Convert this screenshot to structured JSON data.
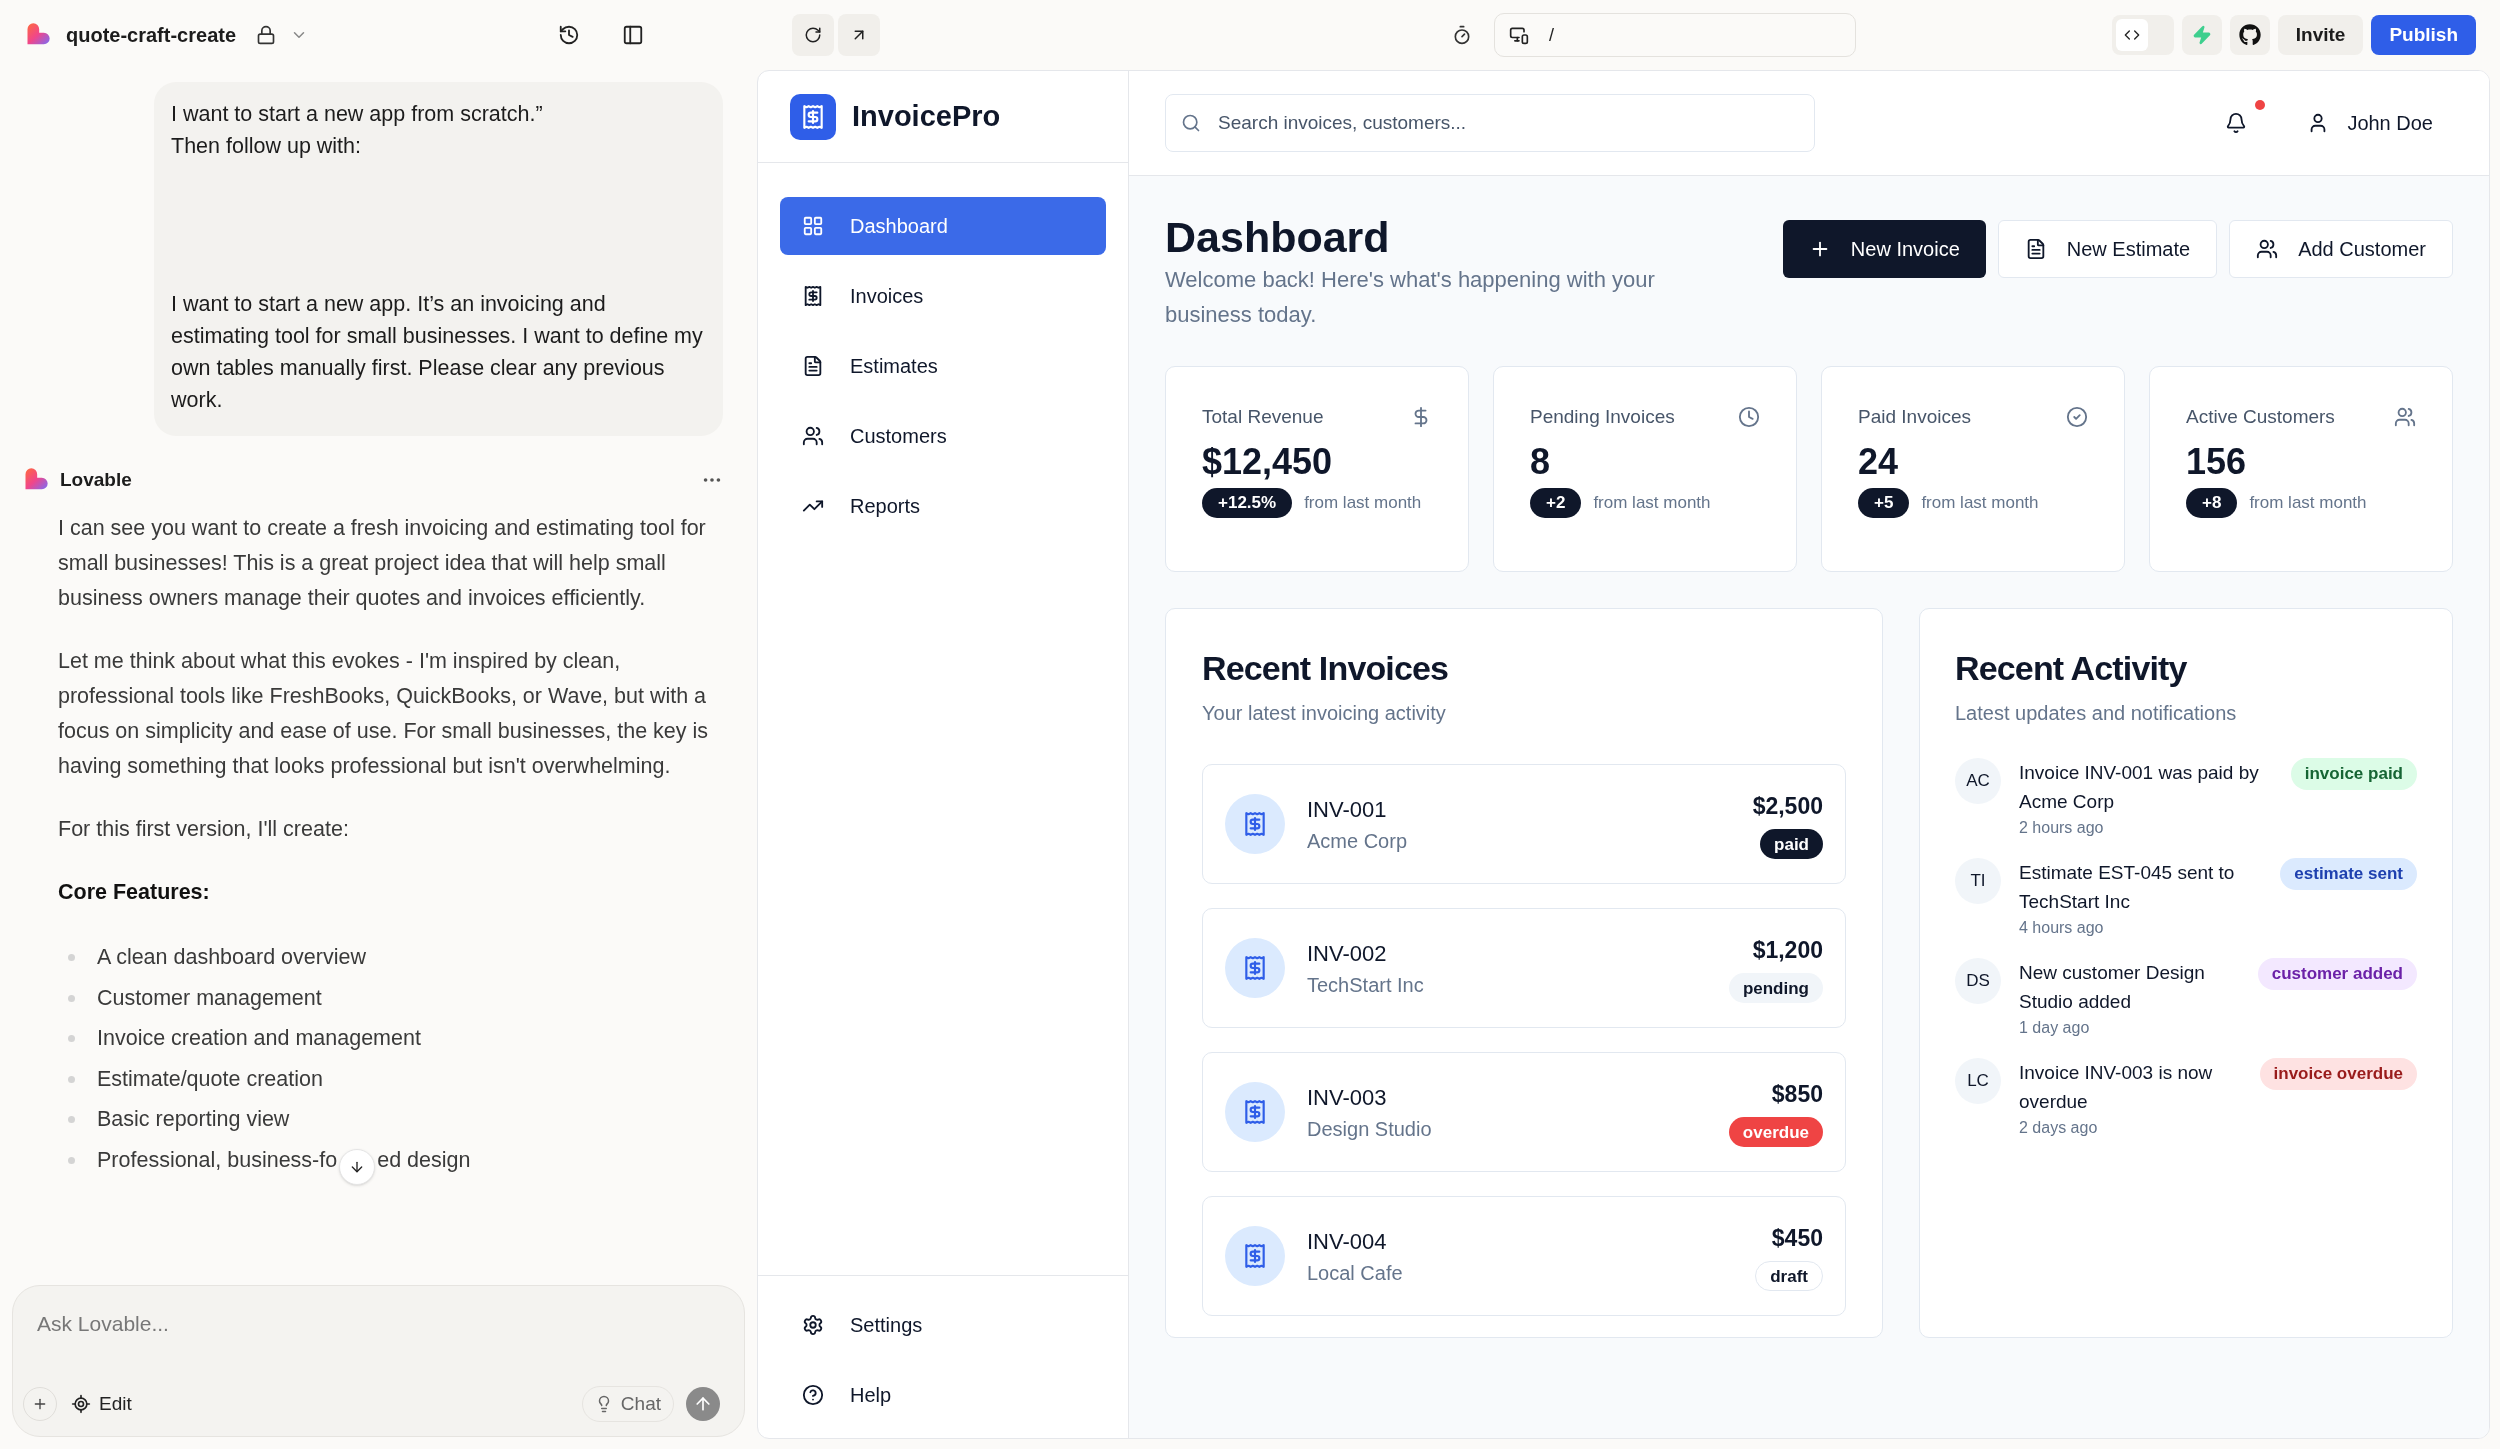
{
  "topbar": {
    "project": "quote-craft-create",
    "route": "/",
    "code_view": false,
    "buttons": [
      "Invite",
      "Publish"
    ]
  },
  "chat": {
    "user_message": [
      "I want to start a new app from scratch.”\nThen follow up with:",
      "I want to start a new app. It’s an invoicing and estimating tool for small businesses. I want to define my own tables manually first. Please clear any previous work."
    ],
    "assistant_name": "Lovable",
    "paragraphs": [
      "I can see you want to create a fresh invoicing and estimating tool for small businesses! This is a great project idea that will help small business owners manage their quotes and invoices efficiently.",
      "Let me think about what this evokes - I'm inspired by clean, professional tools like FreshBooks, QuickBooks, or Wave, but with a focus on simplicity and ease of use. For small businesses, the key is having something that looks professional but isn't overwhelming.",
      "For this first version, I'll create:"
    ],
    "heading": "Core Features:",
    "bullets": [
      [
        "A clean dashboard overview"
      ],
      [
        "Customer management"
      ],
      [
        "Invoice creation and management"
      ],
      [
        "Estimate/quote creation"
      ],
      [
        "Basic reporting view"
      ],
      [
        "Professional, business-fo",
        "ed design"
      ]
    ],
    "composer": {
      "placeholder": "Ask Lovable...",
      "edit": "Edit",
      "chat": "Chat"
    }
  },
  "app": {
    "brand": "InvoicePro",
    "nav": [
      {
        "label": "Dashboard",
        "selected": true
      },
      {
        "label": "Invoices",
        "selected": false
      },
      {
        "label": "Estimates",
        "selected": false
      },
      {
        "label": "Customers",
        "selected": false
      },
      {
        "label": "Reports",
        "selected": false
      }
    ],
    "nav_bottom": [
      "Settings",
      "Help"
    ],
    "search": {
      "placeholder": "Search invoices, customers..."
    },
    "notifications_unread": true,
    "user": "John Doe",
    "title": "Dashboard",
    "subtitle": "Welcome back! Here's what's happening with your business today.",
    "actions": [
      {
        "label": "New Invoice",
        "primary": true
      },
      {
        "label": "New Estimate",
        "primary": false
      },
      {
        "label": "Add Customer",
        "primary": false
      }
    ],
    "stats": [
      {
        "label": "Total Revenue",
        "value": "$12,450",
        "change": "+12.5%",
        "note": "from last month"
      },
      {
        "label": "Pending Invoices",
        "value": "8",
        "change": "+2",
        "note": "from last month"
      },
      {
        "label": "Paid Invoices",
        "value": "24",
        "change": "+5",
        "note": "from last month"
      },
      {
        "label": "Active Customers",
        "value": "156",
        "change": "+8",
        "note": "from last month"
      }
    ],
    "recent_invoices": {
      "title": "Recent Invoices",
      "subtitle": "Your latest invoicing activity",
      "rows": [
        {
          "number": "INV-001",
          "customer": "Acme Corp",
          "amount": "$2,500",
          "status": "paid",
          "kind": "paid"
        },
        {
          "number": "INV-002",
          "customer": "TechStart Inc",
          "amount": "$1,200",
          "status": "pending",
          "kind": "pending"
        },
        {
          "number": "INV-003",
          "customer": "Design Studio",
          "amount": "$850",
          "status": "overdue",
          "kind": "overdue"
        },
        {
          "number": "INV-004",
          "customer": "Local Cafe",
          "amount": "$450",
          "status": "draft",
          "kind": "draft"
        }
      ]
    },
    "recent_activity": {
      "title": "Recent Activity",
      "subtitle": "Latest updates and notifications",
      "items": [
        {
          "initials": "AC",
          "text": "Invoice INV-001 was paid by Acme Corp",
          "time": "2 hours ago",
          "tag": "invoice paid",
          "color": "#dcfce7"
        },
        {
          "initials": "TI",
          "text": "Estimate EST-045 sent to TechStart Inc",
          "time": "4 hours ago",
          "tag": "estimate sent",
          "color": "#dbeafe"
        },
        {
          "initials": "DS",
          "text": "New customer Design Studio added",
          "time": "1 day ago",
          "tag": "customer added",
          "color": "#f3e8ff"
        },
        {
          "initials": "LC",
          "text": "Invoice INV-003 is now overdue",
          "time": "2 days ago",
          "tag": "invoice overdue",
          "color": "#fee2e2"
        }
      ]
    }
  }
}
